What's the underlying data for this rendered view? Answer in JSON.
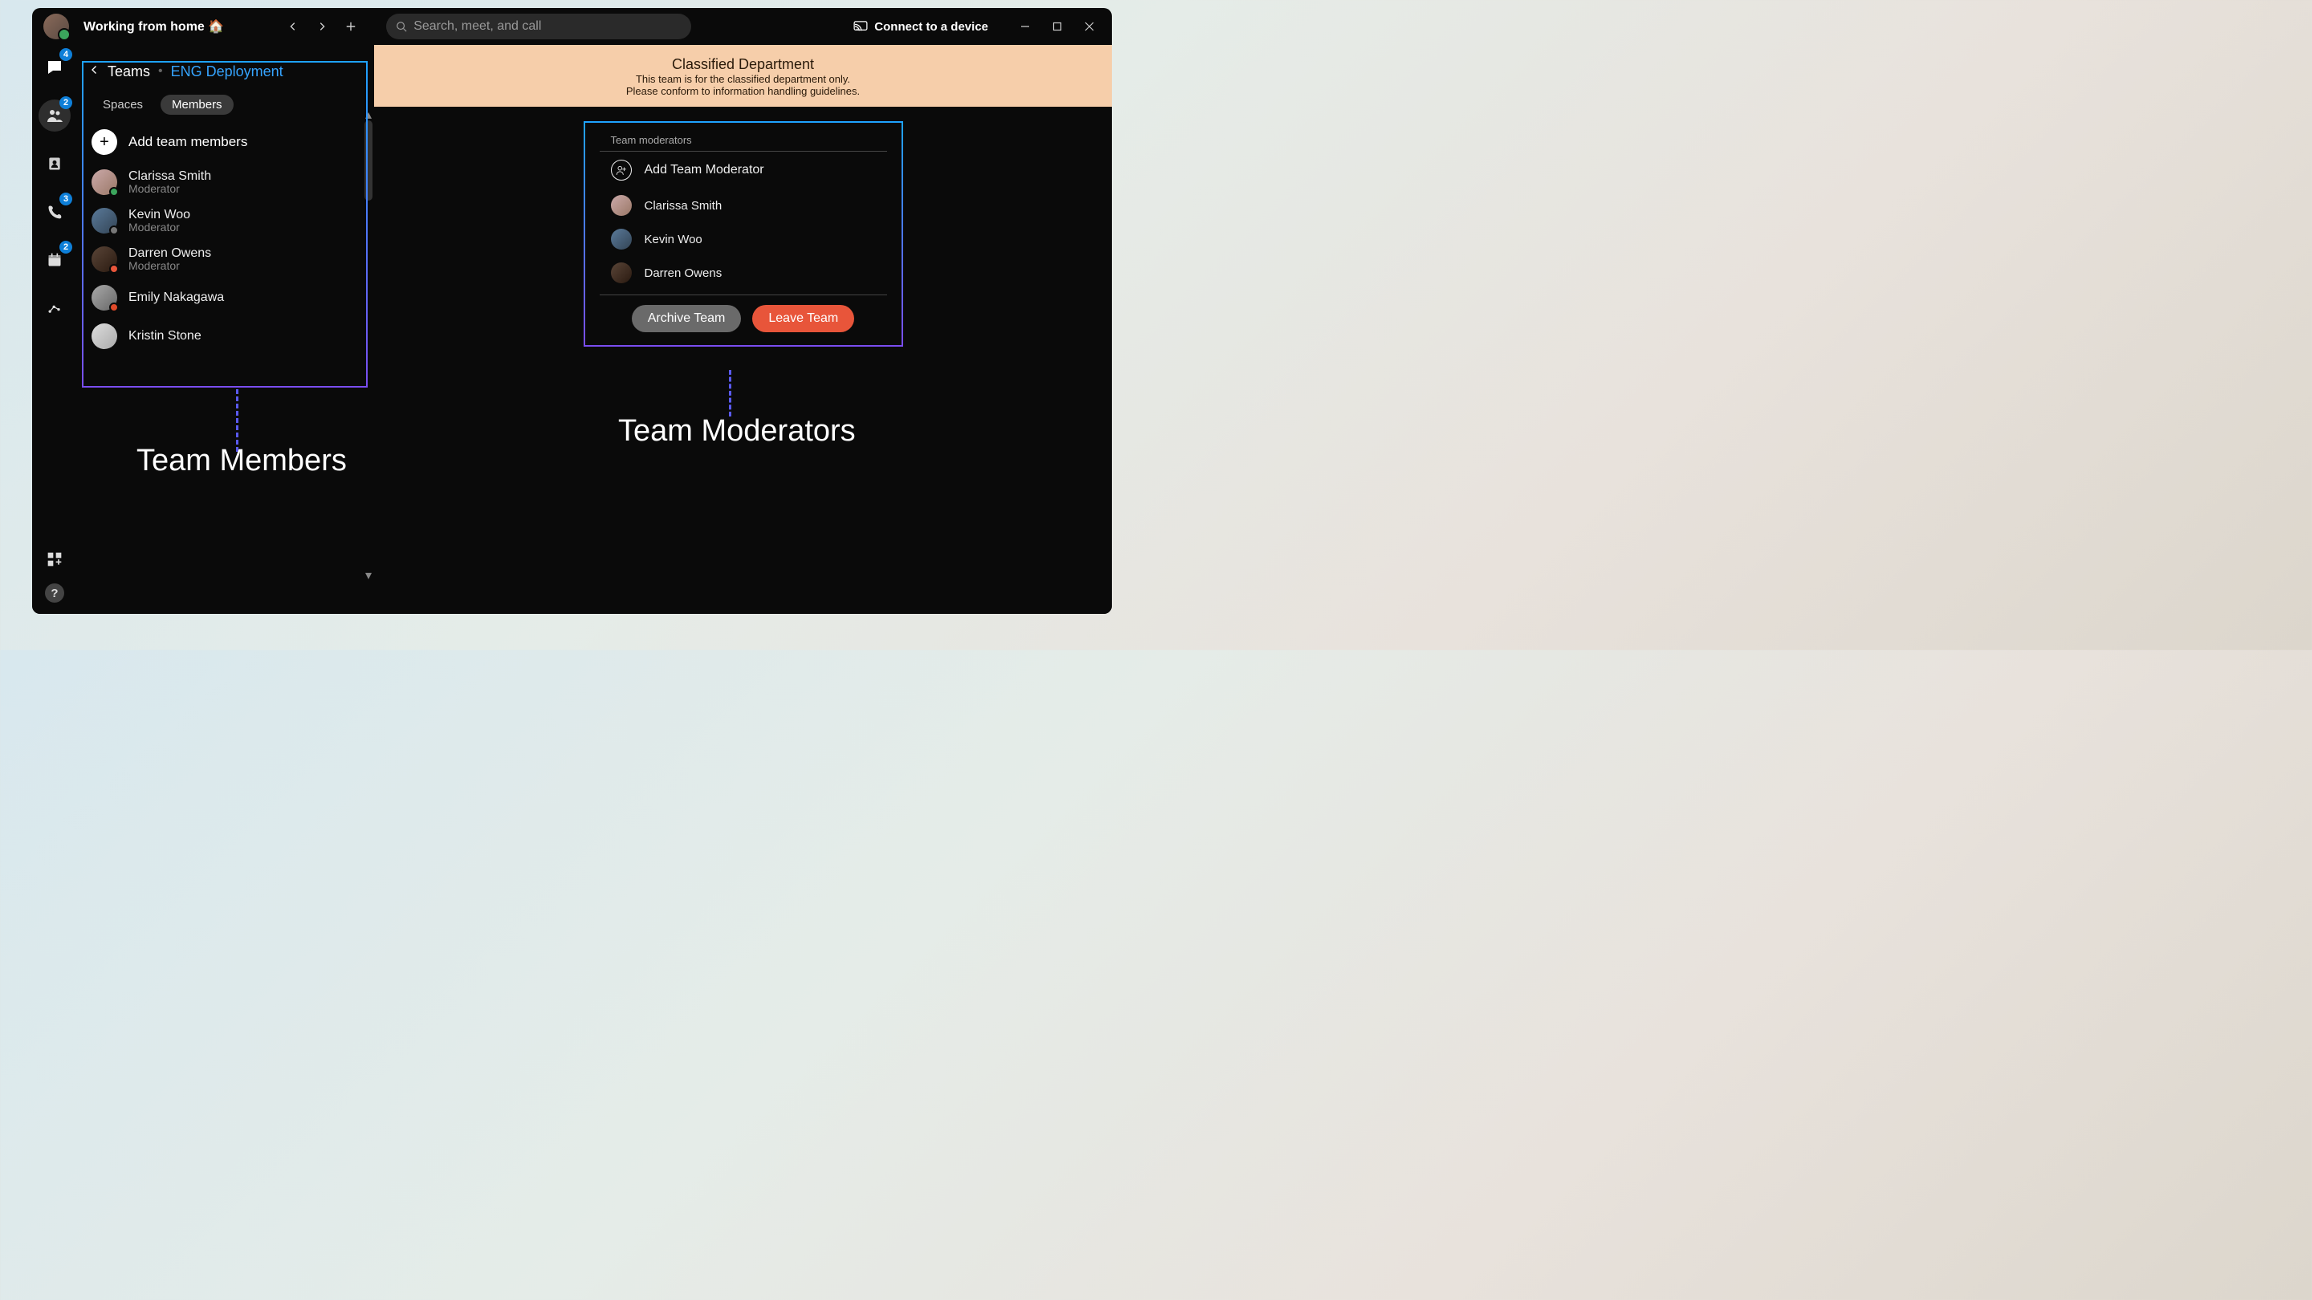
{
  "titlebar": {
    "status": "Working from home 🏠",
    "search_placeholder": "Search, meet, and call",
    "connect": "Connect to a device"
  },
  "rail": {
    "chat_badge": "4",
    "teams_badge": "2",
    "calls_badge": "3",
    "calendar_badge": "2"
  },
  "sidepanel": {
    "crumb_root": "Teams",
    "crumb_team": "ENG Deployment",
    "tabs": [
      "Spaces",
      "Members"
    ],
    "active_tab": 1,
    "add_label": "Add team members",
    "members": [
      {
        "name": "Clarissa Smith",
        "role": "Moderator",
        "avatar": "avatar-color-1",
        "presence": "pres-green"
      },
      {
        "name": "Kevin Woo",
        "role": "Moderator",
        "avatar": "avatar-color-2",
        "presence": "pres-clock"
      },
      {
        "name": "Darren Owens",
        "role": "Moderator",
        "avatar": "avatar-color-3",
        "presence": "pres-call"
      },
      {
        "name": "Emily Nakagawa",
        "role": "",
        "avatar": "avatar-color-4",
        "presence": "pres-dnd"
      },
      {
        "name": "Kristin Stone",
        "role": "",
        "avatar": "avatar-color-5",
        "presence": ""
      }
    ]
  },
  "banner": {
    "title": "Classified Department",
    "line1": "This team is for the classified department only.",
    "line2": "Please conform to information handling guidelines."
  },
  "mods": {
    "title": "Team moderators",
    "add_label": "Add Team Moderator",
    "list": [
      {
        "name": "Clarissa Smith",
        "avatar": "avatar-color-1"
      },
      {
        "name": "Kevin Woo",
        "avatar": "avatar-color-2"
      },
      {
        "name": "Darren Owens",
        "avatar": "avatar-color-3"
      }
    ],
    "archive": "Archive Team",
    "leave": "Leave Team"
  },
  "callouts": {
    "members": "Team Members",
    "moderators": "Team Moderators"
  }
}
